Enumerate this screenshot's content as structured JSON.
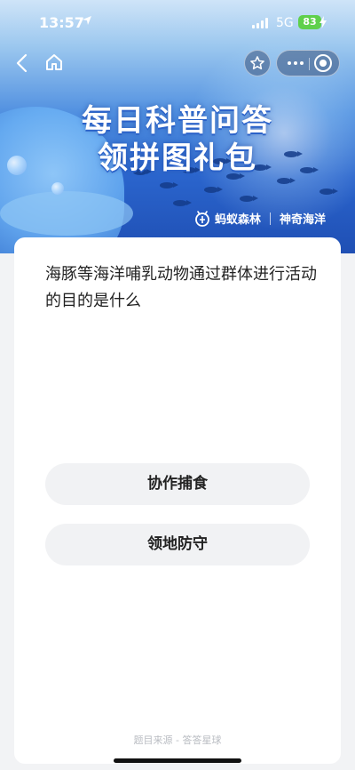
{
  "status_bar": {
    "time": "13:57",
    "network": "5G",
    "battery": "83"
  },
  "icons": {
    "back": "chevron-left-icon",
    "home": "home-icon",
    "star": "star-icon",
    "more": "more-icon",
    "close": "close-circle-icon",
    "location": "location-arrow-icon",
    "brand_logo": "ant-forest-logo"
  },
  "banner": {
    "title_line1": "每日科普问答",
    "title_line2": "领拼图礼包",
    "brand_left": "蚂蚁森林",
    "brand_right": "神奇海洋"
  },
  "quiz": {
    "question": "海豚等海洋哺乳动物通过群体进行活动的目的是什么",
    "options": [
      "协作捕食",
      "领地防守"
    ],
    "source": "题目来源 - 答答星球"
  },
  "colors": {
    "banner_top": "#cfe4f8",
    "banner_bottom": "#1f4fb4",
    "battery": "#5fd04b",
    "option_bg": "#f1f2f4",
    "page_bg": "#f2f3f5"
  }
}
